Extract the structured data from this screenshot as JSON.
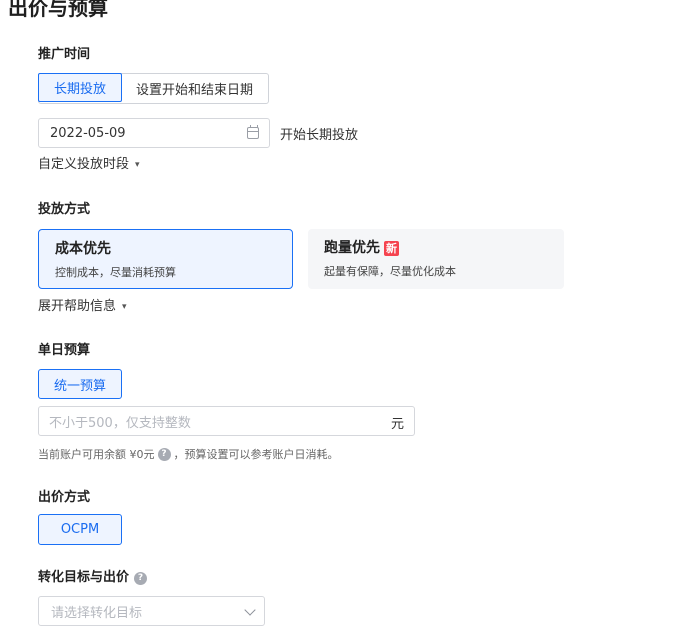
{
  "page": {
    "title": "出价与预算"
  },
  "schedule": {
    "title": "推广时间",
    "options": [
      "长期投放",
      "设置开始和结束日期"
    ],
    "start_date": "2022-05-09",
    "start_suffix": "开始长期投放",
    "custom_toggle": "自定义投放时段"
  },
  "delivery": {
    "title": "投放方式",
    "cards": [
      {
        "title": "成本优先",
        "desc": "控制成本，尽量消耗预算",
        "badge": ""
      },
      {
        "title": "跑量优先",
        "desc": "起量有保障，尽量优化成本",
        "badge": "新"
      }
    ],
    "help_toggle": "展开帮助信息"
  },
  "budget": {
    "title": "单日预算",
    "option": "统一预算",
    "placeholder": "不小于500，仅支持整数",
    "unit": "元",
    "hint_prefix": "当前账户可用余额 ¥0元",
    "hint_suffix": "，预算设置可以参考账户日消耗。"
  },
  "bidding": {
    "title": "出价方式",
    "option": "OCPM"
  },
  "conversion": {
    "title": "转化目标与出价",
    "placeholder": "请选择转化目标"
  },
  "icons": {
    "calendar": "calendar-icon",
    "chevron": "double-chevron-down-icon",
    "help": "question-circle-icon",
    "select": "chevron-down-icon"
  },
  "colors": {
    "accent": "#1a70f5",
    "active_bg": "#eef4ff",
    "badge": "#f5434f",
    "card_inactive_bg": "#f5f6f8"
  }
}
